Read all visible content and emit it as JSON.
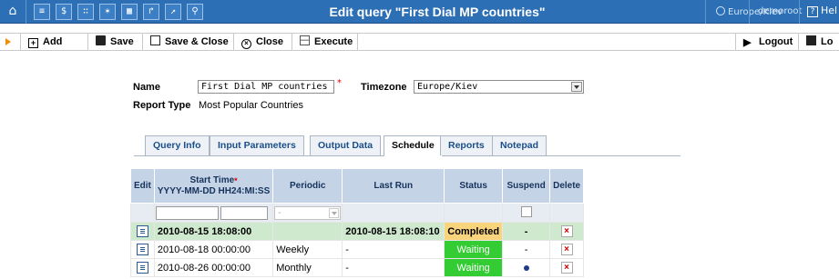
{
  "window": {
    "title": "Edit query \"First Dial MP countries\"",
    "timezone": "Europe/Kiev",
    "user": "demoroot",
    "help_label": "Hel"
  },
  "topbar_icons": [
    "home-icon",
    "list-icon",
    "currency-icon",
    "grid-icon",
    "person-icon",
    "calendar-icon",
    "report-icon",
    "chart-icon",
    "search-icon"
  ],
  "toolbar": {
    "add_label": "Add",
    "save_label": "Save",
    "save_close_label": "Save & Close",
    "close_label": "Close",
    "execute_label": "Execute",
    "logout_label": "Logout",
    "log_label": "Lo"
  },
  "form": {
    "name_label": "Name",
    "name_value": "First Dial MP countries",
    "timezone_label": "Timezone",
    "timezone_value": "Europe/Kiev",
    "report_type_label": "Report Type",
    "report_type_value": "Most Popular Countries",
    "required_mark": "*"
  },
  "tabs": [
    {
      "label": "Query Info"
    },
    {
      "label": "Input Parameters"
    },
    {
      "label": "Output Data"
    },
    {
      "label": "Schedule",
      "active": true
    },
    {
      "label": "Reports"
    },
    {
      "label": "Notepad"
    }
  ],
  "schedule": {
    "headers": {
      "edit": "Edit",
      "start_time": "Start Time",
      "start_time_format": "YYYY-MM-DD HH24:MI:SS",
      "periodic": "Periodic",
      "last_run": "Last Run",
      "status": "Status",
      "suspend": "Suspend",
      "delete": "Delete"
    },
    "filter": {
      "periodic_placeholder": "-"
    },
    "rows": [
      {
        "start_time": "2010-08-15 18:08:00",
        "periodic": "",
        "last_run": "2010-08-15 18:08:10",
        "status": "Completed",
        "suspend": "-"
      },
      {
        "start_time": "2010-08-18 00:00:00",
        "periodic": "Weekly",
        "last_run": "-",
        "status": "Waiting",
        "suspend": "-"
      },
      {
        "start_time": "2010-08-26 00:00:00",
        "periodic": "Monthly",
        "last_run": "-",
        "status": "Waiting",
        "suspend": ""
      }
    ]
  },
  "colors": {
    "topbar": "#2c6fb5",
    "completed": "#f8d47c",
    "waiting": "#33cc33",
    "row_highlight": "#cfe9cf",
    "header": "#c4d4e6"
  }
}
